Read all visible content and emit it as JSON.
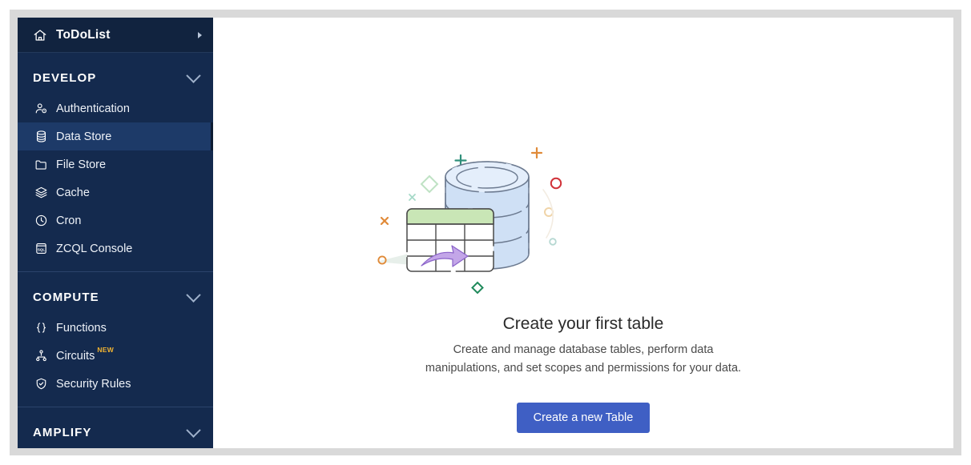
{
  "app": {
    "project_name": "ToDoList"
  },
  "sidebar": {
    "header": {
      "label": "ToDoList",
      "home_icon": "home-icon",
      "expand_icon": "caret-right-icon"
    },
    "groups": [
      {
        "title": "DEVELOP",
        "collapse_icon": "chevron-down-icon",
        "items": [
          {
            "label": "Authentication",
            "icon": "user-auth-icon",
            "active": false,
            "badge": ""
          },
          {
            "label": "Data Store",
            "icon": "database-icon",
            "active": true,
            "badge": ""
          },
          {
            "label": "File Store",
            "icon": "folder-icon",
            "active": false,
            "badge": ""
          },
          {
            "label": "Cache",
            "icon": "layers-icon",
            "active": false,
            "badge": ""
          },
          {
            "label": "Cron",
            "icon": "clock-icon",
            "active": false,
            "badge": ""
          },
          {
            "label": "ZCQL Console",
            "icon": "sql-console-icon",
            "active": false,
            "badge": ""
          }
        ]
      },
      {
        "title": "COMPUTE",
        "collapse_icon": "chevron-down-icon",
        "items": [
          {
            "label": "Functions",
            "icon": "braces-icon",
            "active": false,
            "badge": ""
          },
          {
            "label": "Circuits",
            "icon": "circuit-nodes-icon",
            "active": false,
            "badge": "NEW"
          },
          {
            "label": "Security Rules",
            "icon": "shield-check-icon",
            "active": false,
            "badge": ""
          }
        ]
      },
      {
        "title": "AMPLIFY",
        "collapse_icon": "chevron-down-icon",
        "items": []
      }
    ]
  },
  "main": {
    "empty_state": {
      "illustration_name": "database-table-illustration",
      "title": "Create your first table",
      "description": "Create and manage database tables, perform data manipulations, and set scopes and permissions for your data.",
      "button_label": "Create a new Table"
    }
  },
  "colors": {
    "sidebar_bg": "#142a4e",
    "sidebar_header_bg": "#11233f",
    "sidebar_active": "#1d3a68",
    "primary_button": "#3f5fc4",
    "badge_new": "#f2b431",
    "illustration_db_fill": "#cfe0f5",
    "illustration_table_header": "#c9e6b6",
    "illustration_arrow": "#c3a6e8",
    "frame_gray": "#d9d9d9"
  }
}
